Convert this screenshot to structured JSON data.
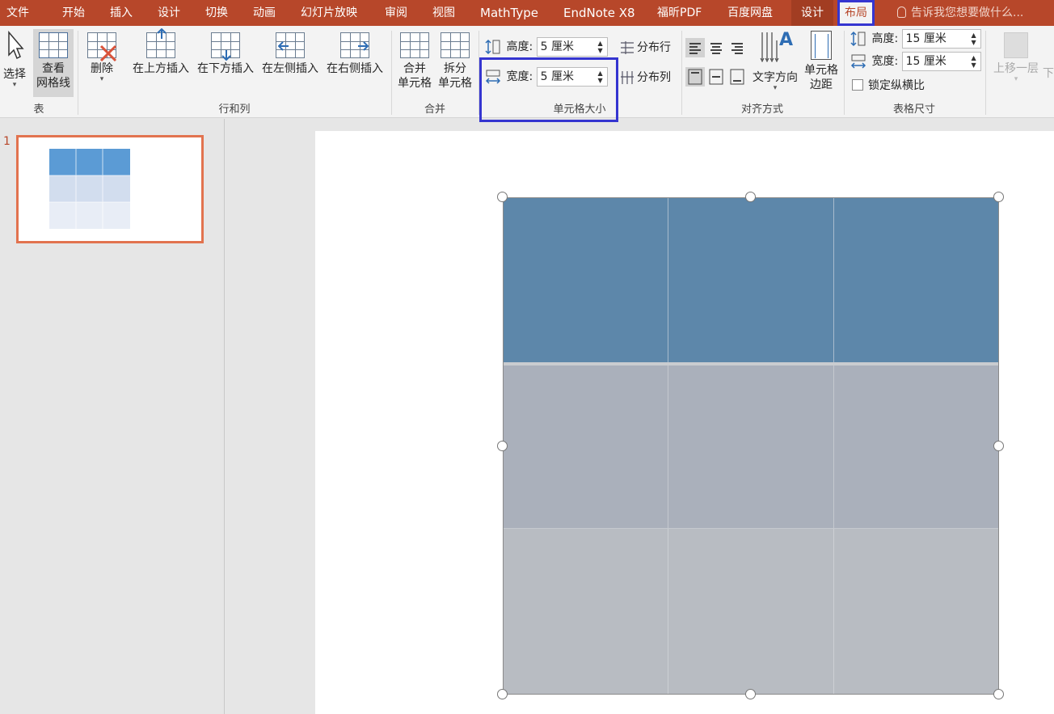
{
  "menu": {
    "tabs": [
      "文件",
      "开始",
      "插入",
      "设计",
      "切换",
      "动画",
      "幻灯片放映",
      "审阅",
      "视图",
      "MathType",
      "EndNote X8",
      "福昕PDF",
      "百度网盘"
    ],
    "design_tab": "设计",
    "layout_tab": "布局",
    "tell_me": "告诉我您想要做什么..."
  },
  "ribbon": {
    "table_group": {
      "label": "表",
      "select": "选择",
      "view_gridlines_1": "查看",
      "view_gridlines_2": "网格线"
    },
    "rows_cols_group": {
      "label": "行和列",
      "delete": "删除",
      "insert_above": "在上方插入",
      "insert_below": "在下方插入",
      "insert_left": "在左侧插入",
      "insert_right": "在右侧插入"
    },
    "merge_group": {
      "label": "合并",
      "merge_1": "合并",
      "merge_2": "单元格",
      "split_1": "拆分",
      "split_2": "单元格"
    },
    "cell_size_group": {
      "label": "单元格大小",
      "height_label": "高度:",
      "height_value": "5 厘米",
      "width_label": "宽度:",
      "width_value": "5 厘米",
      "distribute_rows": "分布行",
      "distribute_cols": "分布列"
    },
    "alignment_group": {
      "label": "对齐方式",
      "text_direction": "文字方向",
      "cell_margins_1": "单元格",
      "cell_margins_2": "边距"
    },
    "table_size_group": {
      "label": "表格尺寸",
      "height_label": "高度:",
      "height_value": "15 厘米",
      "width_label": "宽度:",
      "width_value": "15 厘米",
      "lock_ratio": "锁定纵横比"
    },
    "arrange_group": {
      "bring_forward": "上移一层",
      "send_backward_partial": "下"
    }
  },
  "slides_panel": {
    "slide_number": "1"
  },
  "colors": {
    "accent": "#b7472a",
    "header_cell": "#5d87aa",
    "body_cell_1": "#aab0bb",
    "body_cell_2": "#b8bcc2",
    "highlight_box": "#3535d0"
  }
}
